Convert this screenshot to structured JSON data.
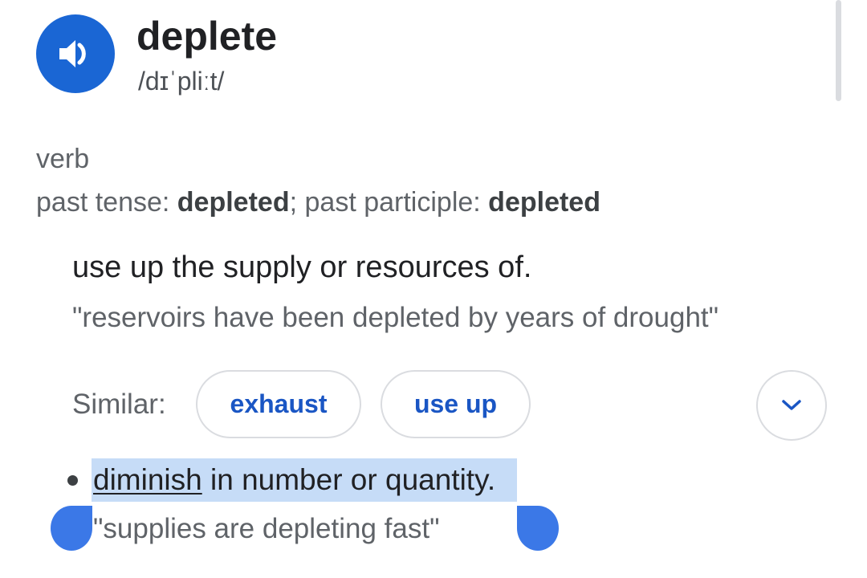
{
  "entry": {
    "word": "deplete",
    "phonetic": "/dɪˈpliːt/",
    "speaker_icon": "speaker-volume-icon",
    "accent_color": "#1a66d4"
  },
  "grammar": {
    "part_of_speech": "verb",
    "past_tense_label": "past tense: ",
    "past_tense": "depleted",
    "separator": "; ",
    "past_participle_label": "past participle: ",
    "past_participle": "depleted"
  },
  "sense1": {
    "definition": "use up the supply or resources of.",
    "example": "\"reservoirs have been depleted by years of drought\"",
    "similar_label": "Similar:",
    "similar": [
      "exhaust",
      "use up"
    ],
    "expand_icon": "chevron-down-icon"
  },
  "sense2": {
    "link_word": "diminish",
    "definition_rest": " in number or quantity",
    "period": ".",
    "example": "\"supplies are depleting fast\""
  },
  "selection": {
    "highlight_color": "#c6dcf7",
    "handle_color": "#3b78e7"
  }
}
